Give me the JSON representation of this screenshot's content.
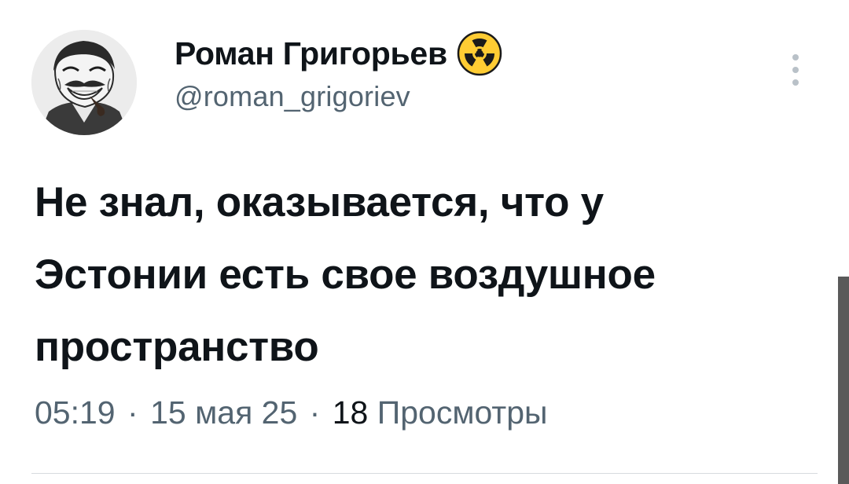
{
  "author": {
    "display_name": "Роман Григорьев",
    "handle": "@roman_grigoriev",
    "badge_icon": "radioactive-icon",
    "avatar_icon": "trollface-stalin-avatar"
  },
  "tweet": {
    "text_lines": [
      "Не знал, оказывается, что у",
      "Эстонии есть свое воздушное",
      "пространство"
    ],
    "time": "05:19",
    "date": "15 мая 25",
    "separator": "·",
    "views_count": "18",
    "views_label": "Просмотры"
  },
  "colors": {
    "text_primary": "#0f1419",
    "text_secondary": "#536471",
    "badge_yellow": "#ffcc33",
    "badge_black": "#1a1a1a",
    "divider": "#d7dbdf",
    "scrollbar": "#5a5a5a"
  },
  "icons": {
    "more": "more-vertical-icon"
  }
}
